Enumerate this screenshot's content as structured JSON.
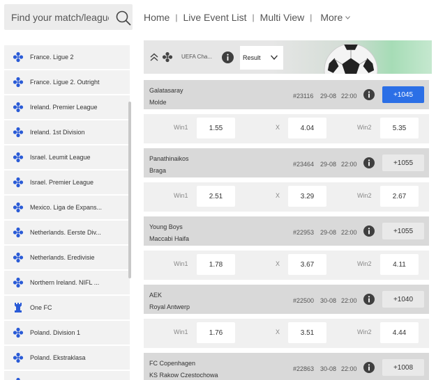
{
  "search": {
    "placeholder": "Find your match/league"
  },
  "nav": {
    "items": [
      "Home",
      "Live Event List",
      "Multi View"
    ],
    "more_label": "More"
  },
  "sidebar": {
    "items": [
      {
        "label": "France. Ligue 2",
        "icon": "soccer-ball-icon"
      },
      {
        "label": "France. Ligue 2. Outright",
        "icon": "soccer-ball-icon"
      },
      {
        "label": "Ireland. Premier League",
        "icon": "soccer-ball-icon"
      },
      {
        "label": "Ireland. 1st Division",
        "icon": "soccer-ball-icon"
      },
      {
        "label": "Israel. Leumit League",
        "icon": "soccer-ball-icon"
      },
      {
        "label": "Israel. Premier League",
        "icon": "soccer-ball-icon"
      },
      {
        "label": "Mexico. Liga de Expans...",
        "icon": "soccer-ball-icon"
      },
      {
        "label": "Netherlands. Eerste Div...",
        "icon": "soccer-ball-icon"
      },
      {
        "label": "Netherlands. Eredivisie",
        "icon": "soccer-ball-icon"
      },
      {
        "label": "Northern Ireland. NIFL ...",
        "icon": "soccer-ball-icon"
      },
      {
        "label": "One FC",
        "icon": "tower-icon"
      },
      {
        "label": "Poland. Division 1",
        "icon": "soccer-ball-icon"
      },
      {
        "label": "Poland. Ekstraklasa",
        "icon": "soccer-ball-icon"
      }
    ]
  },
  "header": {
    "league": "UEFA Cha...",
    "market_select": "Result"
  },
  "labels": {
    "win1": "Win1",
    "draw": "X",
    "win2": "Win2"
  },
  "matches": [
    {
      "team1": "Galatasaray",
      "team2": "Molde",
      "id": "#23116",
      "date": "29-08",
      "time": "22:00",
      "more": "+1045",
      "active": true,
      "odds": [
        "1.55",
        "4.04",
        "5.35"
      ]
    },
    {
      "team1": "Panathinaikos",
      "team2": "Braga",
      "id": "#23464",
      "date": "29-08",
      "time": "22:00",
      "more": "+1055",
      "active": false,
      "odds": [
        "2.51",
        "3.29",
        "2.67"
      ]
    },
    {
      "team1": "Young Boys",
      "team2": "Maccabi Haifa",
      "id": "#22953",
      "date": "29-08",
      "time": "22:00",
      "more": "+1055",
      "active": false,
      "odds": [
        "1.78",
        "3.67",
        "4.11"
      ]
    },
    {
      "team1": "AEK",
      "team2": "Royal Antwerp",
      "id": "#22500",
      "date": "30-08",
      "time": "22:00",
      "more": "+1040",
      "active": false,
      "odds": [
        "1.76",
        "3.51",
        "4.44"
      ]
    },
    {
      "team1": "FC Copenhagen",
      "team2": "KS Rakow Czestochowa",
      "id": "#22863",
      "date": "30-08",
      "time": "22:00",
      "more": "+1008",
      "active": false,
      "odds": []
    }
  ],
  "colors": {
    "accent": "#2b6fe6",
    "icon_blue": "#2a5bd7"
  }
}
